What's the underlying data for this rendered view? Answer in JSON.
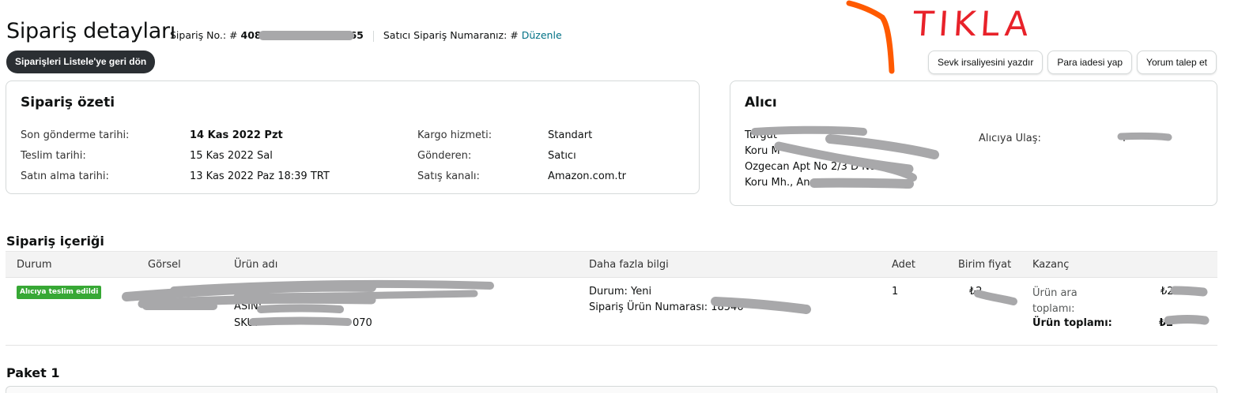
{
  "header": {
    "title": "Sipariş detayları",
    "order_no_label": "Sipariş No.: #",
    "order_no_prefix": "408-",
    "order_no_suffix": "365",
    "seller_order_label": "Satıcı Sipariş Numaranız: #",
    "edit_link": "Düzenle",
    "back_button": "Siparişleri Listele'ye geri dön"
  },
  "actions": [
    {
      "label": "Sevk irsaliyesini yazdır"
    },
    {
      "label": "Para iadesi yap"
    },
    {
      "label": "Yorum talep et"
    }
  ],
  "annotation": {
    "text": "TIKLA",
    "color": "#e8222a",
    "arrow_color": "#ff5a00"
  },
  "summary": {
    "title": "Sipariş özeti",
    "left": [
      {
        "label": "Son gönderme tarihi:",
        "value": "14 Kas 2022 Pzt"
      },
      {
        "label": "Teslim tarihi:",
        "value": "15 Kas 2022 Sal"
      },
      {
        "label": "Satın alma tarihi:",
        "value": "13 Kas 2022 Paz 18:39 TRT"
      }
    ],
    "right": [
      {
        "label": "Kargo hizmeti:",
        "value": "Standart"
      },
      {
        "label": "Gönderen:",
        "value": "Satıcı"
      },
      {
        "label": "Satış kanalı:",
        "value": "Amazon.com.tr"
      }
    ]
  },
  "recipient": {
    "title": "Alıcı",
    "address_lines": [
      "Turgut",
      "Koru M",
      "Ozgecan Apt No 2/3 D No 9",
      "Koru Mh., An"
    ],
    "contact_label": "Alıcıya Ulaş:",
    "contact_value": "T"
  },
  "contents": {
    "title": "Sipariş içeriği",
    "columns": [
      "Durum",
      "Görsel",
      "Ürün adı",
      "Daha fazla bilgi",
      "Adet",
      "Birim fiyat",
      "Kazanç"
    ],
    "row": {
      "status": "Alıcıya teslim edildi",
      "asin_label": "ASIN:",
      "sku_label": "SKU:",
      "sku_suffix": "070",
      "condition": "Durum: Yeni",
      "order_item_no": "Sipariş Ürün Numarası: 18546",
      "quantity": "1",
      "unit_price": "₺2",
      "subtotal_label": "Ürün ara toplamı:",
      "subtotal_value": "₺25",
      "total_label": "Ürün toplamı:",
      "total_value": "₺2"
    }
  },
  "package": {
    "title": "Paket 1"
  }
}
